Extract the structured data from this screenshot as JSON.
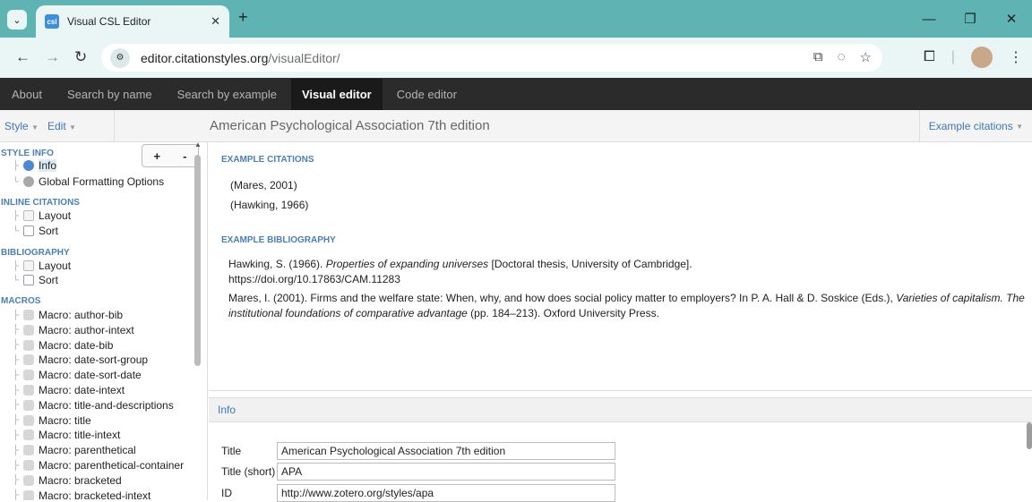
{
  "browser": {
    "tab_title": "Visual CSL Editor",
    "favicon_text": "csl",
    "url_host": "editor.citationstyles.org",
    "url_path": "/visualEditor/",
    "window_controls": [
      "minimize-icon",
      "restore-icon",
      "close-icon"
    ]
  },
  "site_nav": {
    "items": [
      "About",
      "Search by name",
      "Search by example",
      "Visual editor",
      "Code editor"
    ],
    "active": "Visual editor"
  },
  "menubar": {
    "style_menu": "Style",
    "edit_menu": "Edit",
    "title": "American Psychological Association 7th edition",
    "example_menu": "Example citations"
  },
  "sidebar": {
    "plus": "+",
    "minus": "-",
    "style_info": "STYLE INFO",
    "info": "Info",
    "global": "Global Formatting Options",
    "inline": "INLINE CITATIONS",
    "inline_layout": "Layout",
    "inline_sort": "Sort",
    "bibliography": "BIBLIOGRAPHY",
    "bib_layout": "Layout",
    "bib_sort": "Sort",
    "macros_title": "MACROS",
    "macros": [
      "Macro: author-bib",
      "Macro: author-intext",
      "Macro: date-bib",
      "Macro: date-sort-group",
      "Macro: date-sort-date",
      "Macro: date-intext",
      "Macro: title-and-descriptions",
      "Macro: title",
      "Macro: title-intext",
      "Macro: parenthetical",
      "Macro: parenthetical-container",
      "Macro: bracketed",
      "Macro: bracketed-intext"
    ]
  },
  "examples": {
    "citations_heading": "EXAMPLE CITATIONS",
    "citations": [
      "(Mares, 2001)",
      "(Hawking, 1966)"
    ],
    "bibliography_heading": "EXAMPLE BIBLIOGRAPHY",
    "bib1_a": "Hawking, S. (1966). ",
    "bib1_italic": "Properties of expanding universes",
    "bib1_b": " [Doctoral thesis, University of Cambridge].",
    "bib1_doi": "https://doi.org/10.17863/CAM.11283",
    "bib2_a": "Mares, I. (2001). Firms and the welfare state: When, why, and how does social policy matter to employers? In P. A. Hall & D. Soskice (Eds.), ",
    "bib2_italic": "Varieties of capitalism. The institutional foundations of comparative advantage",
    "bib2_b": " (pp. 184–213). Oxford University Press."
  },
  "info_panel": {
    "header": "Info",
    "title_label": "Title",
    "title_value": "American Psychological Association 7th edition",
    "short_label": "Title (short)",
    "short_value": "APA",
    "id_label": "ID",
    "id_value": "http://www.zotero.org/styles/apa"
  }
}
